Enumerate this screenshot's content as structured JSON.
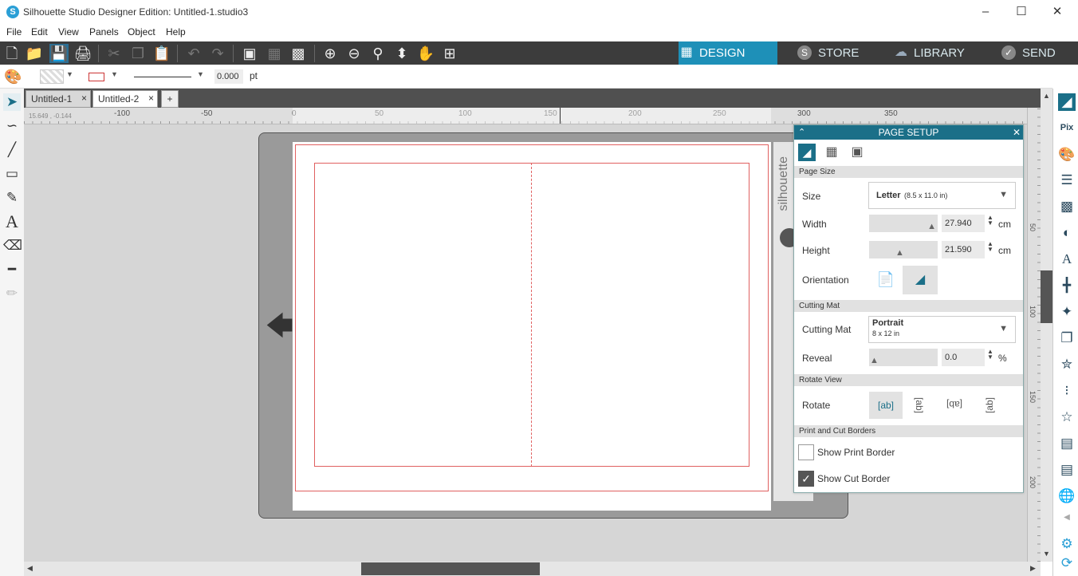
{
  "window": {
    "title": "Silhouette Studio Designer Edition: Untitled-1.studio3",
    "app_icon": "S"
  },
  "menu": [
    "File",
    "Edit",
    "View",
    "Panels",
    "Object",
    "Help"
  ],
  "nav_tabs": [
    {
      "label": "DESIGN",
      "icon": "grid-icon",
      "active": true
    },
    {
      "label": "STORE",
      "icon": "silhouette-s-icon"
    },
    {
      "label": "LIBRARY",
      "icon": "cloud-icon"
    },
    {
      "label": "SEND",
      "icon": "check-circle-icon"
    }
  ],
  "options_bar": {
    "line_width": "0.000",
    "line_unit": "pt"
  },
  "doc_tabs": [
    {
      "label": "Untitled-1",
      "close": "×"
    },
    {
      "label": "Untitled-2",
      "close": "×"
    }
  ],
  "add_tab": "+",
  "ruler": {
    "h_labels": [
      "-100",
      "-50",
      "0",
      "50",
      "100",
      "150",
      "200",
      "250",
      "300",
      "350"
    ],
    "v_labels": [
      "50",
      "100",
      "150",
      "200"
    ],
    "coords": "15.649 , -0.144"
  },
  "mat_brand": "silhouette",
  "panel": {
    "title": "PAGE SETUP",
    "sections": {
      "page_size": "Page Size",
      "cutting_mat": "Cutting Mat",
      "rotate_view": "Rotate View",
      "borders": "Print and Cut Borders"
    },
    "size": {
      "label": "Size",
      "value": "Letter",
      "detail": "(8.5 x 11.0 in)"
    },
    "width": {
      "label": "Width",
      "value": "27.940",
      "unit": "cm"
    },
    "height": {
      "label": "Height",
      "value": "21.590",
      "unit": "cm"
    },
    "orientation": {
      "label": "Orientation",
      "selected": "landscape"
    },
    "mat": {
      "label": "Cutting Mat",
      "value": "Portrait",
      "detail": "8 x 12 in"
    },
    "reveal": {
      "label": "Reveal",
      "value": "0.0",
      "unit": "%"
    },
    "rotate": {
      "label": "Rotate",
      "options": [
        "ab",
        "ab",
        "ab",
        "ab"
      ],
      "selected": 0
    },
    "show_print_border": {
      "label": "Show Print Border",
      "checked": false
    },
    "show_cut_border": {
      "label": "Show Cut Border",
      "checked": true
    }
  },
  "colors": {
    "accent": "#1e90b8",
    "panel_header": "#1b6f88",
    "toolbar": "#3c3c3c",
    "cut_border": "#e06060"
  }
}
